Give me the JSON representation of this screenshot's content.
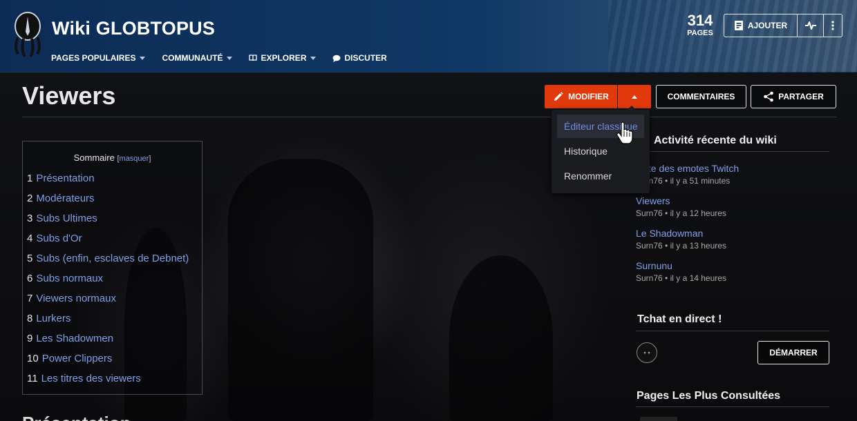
{
  "header": {
    "wiki_title": "Wiki GLOBTOPUS",
    "nav": [
      {
        "label": "PAGES POPULAIRES",
        "icon": "none",
        "caret": true
      },
      {
        "label": "COMMUNAUTÉ",
        "icon": "none",
        "caret": true
      },
      {
        "label": "EXPLORER",
        "icon": "book-icon",
        "caret": true
      },
      {
        "label": "DISCUTER",
        "icon": "chat-bubble-icon",
        "caret": false
      }
    ],
    "pages_count": "314",
    "pages_label": "PAGES",
    "add_label": "AJOUTER",
    "colors": {
      "header_bg": "#0f3866",
      "accent": "#e1390b",
      "link": "#7f9fe8"
    }
  },
  "page": {
    "title": "Viewers",
    "edit_label": "MODIFIER",
    "comments_label": "COMMENTAIRES",
    "share_label": "PARTAGER",
    "next_heading": "Présentation"
  },
  "edit_menu": {
    "items": [
      "Éditeur classique",
      "Historique",
      "Renommer"
    ],
    "hovered_index": 0
  },
  "toc": {
    "title": "Sommaire",
    "toggle_label": "masquer",
    "items": [
      {
        "num": "1",
        "text": "Présentation"
      },
      {
        "num": "2",
        "text": "Modérateurs"
      },
      {
        "num": "3",
        "text": "Subs Ultimes"
      },
      {
        "num": "4",
        "text": "Subs d'Or"
      },
      {
        "num": "5",
        "text": "Subs (enfin, esclaves de Debnet)"
      },
      {
        "num": "6",
        "text": "Subs normaux"
      },
      {
        "num": "7",
        "text": "Viewers normaux"
      },
      {
        "num": "8",
        "text": "Lurkers"
      },
      {
        "num": "9",
        "text": "Les Shadowmen"
      },
      {
        "num": "10",
        "text": "Power Clippers"
      },
      {
        "num": "11",
        "text": "Les titres des viewers"
      }
    ]
  },
  "recent_activity": {
    "title": "Activité récente du wiki",
    "items": [
      {
        "link": "Liste des emotes Twitch",
        "meta": "Surn76 • il y a 51 minutes"
      },
      {
        "link": "Viewers",
        "meta": "Surn76 • il y a 12 heures"
      },
      {
        "link": "Le Shadowman",
        "meta": "Surn76 • il y a 13 heures"
      },
      {
        "link": "Surnunu",
        "meta": "Surn76 • il y a 14 heures"
      }
    ]
  },
  "chat": {
    "title": "Tchat en direct !",
    "start_label": "DÉMARRER"
  },
  "popular": {
    "title": "Pages Les Plus Consultées"
  }
}
